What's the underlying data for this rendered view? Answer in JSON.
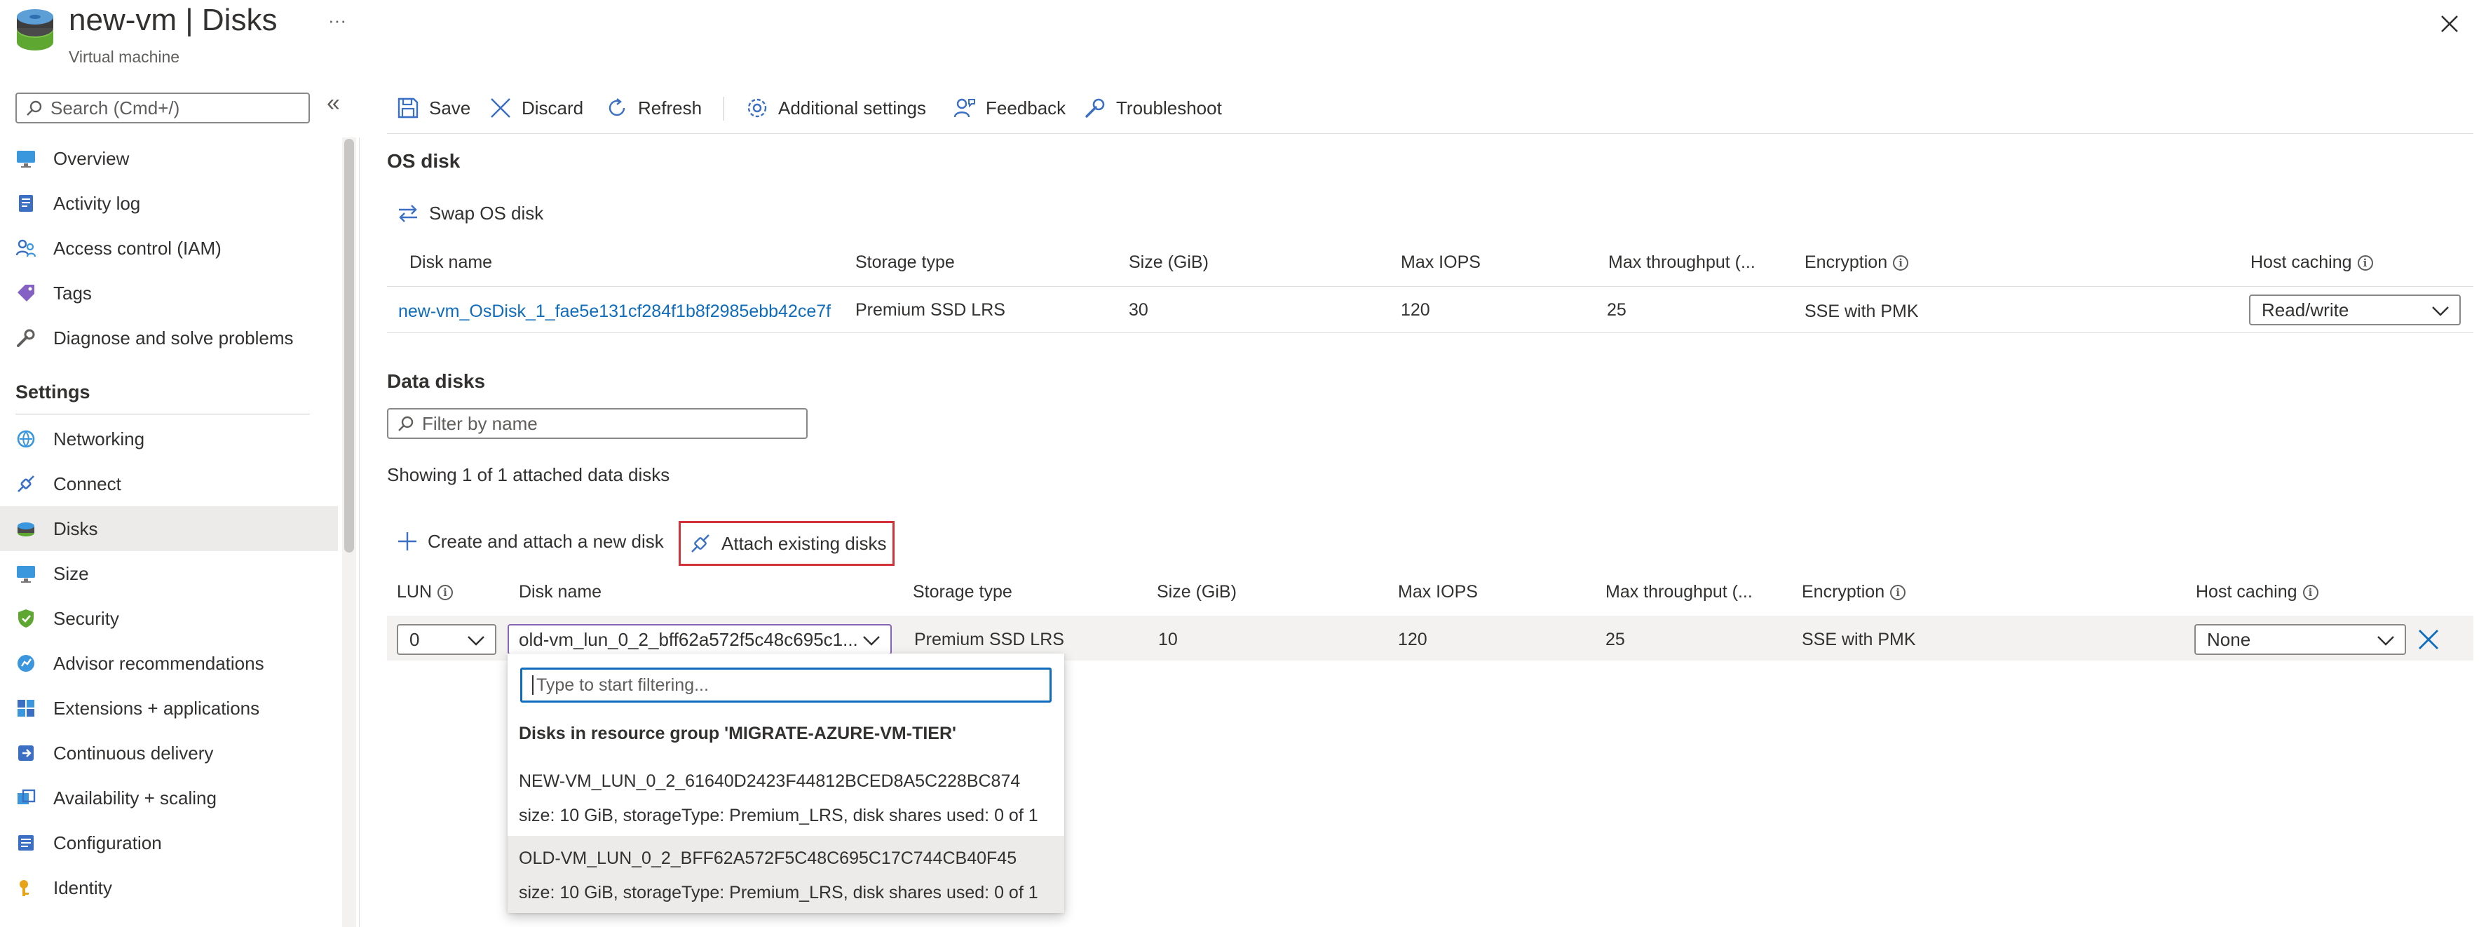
{
  "header": {
    "title": "new-vm | Disks",
    "subtitle": "Virtual machine",
    "more_label": "···"
  },
  "sidebar": {
    "search_placeholder": "Search (Cmd+/)",
    "collapse_label": "«",
    "items": [
      {
        "label": "Overview",
        "icon": "monitor-icon"
      },
      {
        "label": "Activity log",
        "icon": "log-icon"
      },
      {
        "label": "Access control (IAM)",
        "icon": "people-icon"
      },
      {
        "label": "Tags",
        "icon": "tag-icon"
      },
      {
        "label": "Diagnose and solve problems",
        "icon": "wrench-icon"
      }
    ],
    "section_label": "Settings",
    "settings_items": [
      {
        "label": "Networking",
        "icon": "network-icon"
      },
      {
        "label": "Connect",
        "icon": "connect-icon"
      },
      {
        "label": "Disks",
        "icon": "disk-icon",
        "active": true
      },
      {
        "label": "Size",
        "icon": "monitor-icon"
      },
      {
        "label": "Security",
        "icon": "shield-icon"
      },
      {
        "label": "Advisor recommendations",
        "icon": "advisor-icon"
      },
      {
        "label": "Extensions + applications",
        "icon": "extensions-icon"
      },
      {
        "label": "Continuous delivery",
        "icon": "delivery-icon"
      },
      {
        "label": "Availability + scaling",
        "icon": "scaling-icon"
      },
      {
        "label": "Configuration",
        "icon": "config-icon"
      },
      {
        "label": "Identity",
        "icon": "identity-icon"
      }
    ]
  },
  "toolbar": {
    "save": "Save",
    "discard": "Discard",
    "refresh": "Refresh",
    "additional_settings": "Additional settings",
    "feedback": "Feedback",
    "troubleshoot": "Troubleshoot"
  },
  "os_disk": {
    "section_title": "OS disk",
    "swap_label": "Swap OS disk",
    "columns": [
      "Disk name",
      "Storage type",
      "Size (GiB)",
      "Max IOPS",
      "Max throughput (...",
      "Encryption",
      "Host caching"
    ],
    "row": {
      "disk_name": "new-vm_OsDisk_1_fae5e131cf284f1b8f2985ebb42ce7f",
      "storage_type": "Premium SSD LRS",
      "size": "30",
      "max_iops": "120",
      "max_throughput": "25",
      "encryption": "SSE with PMK",
      "host_caching": "Read/write"
    }
  },
  "data_disks": {
    "section_title": "Data disks",
    "filter_placeholder": "Filter by name",
    "showing_text": "Showing 1 of 1 attached data disks",
    "create_attach_label": "Create and attach a new disk",
    "attach_existing_label": "Attach existing disks",
    "columns": [
      "LUN",
      "Disk name",
      "Storage type",
      "Size (GiB)",
      "Max IOPS",
      "Max throughput (...",
      "Encryption",
      "Host caching"
    ],
    "row": {
      "lun": "0",
      "disk_name": "old-vm_lun_0_2_bff62a572f5c48c695c1...",
      "storage_type": "Premium SSD LRS",
      "size": "10",
      "max_iops": "120",
      "max_throughput": "25",
      "encryption": "SSE with PMK",
      "host_caching": "None"
    }
  },
  "dropdown": {
    "filter_placeholder": "Type to start filtering...",
    "group_header": "Disks in resource group 'MIGRATE-AZURE-VM-TIER'",
    "options": [
      {
        "name": "NEW-VM_LUN_0_2_61640D2423F44812BCED8A5C228BC874",
        "detail": "size: 10 GiB, storageType: Premium_LRS, disk shares used: 0 of 1",
        "highlighted": false
      },
      {
        "name": "OLD-VM_LUN_0_2_BFF62A572F5C48C695C17C744CB40F45",
        "detail": "size: 10 GiB, storageType: Premium_LRS, disk shares used: 0 of 1",
        "highlighted": true
      }
    ]
  },
  "colors": {
    "accent": "#0f6cbd",
    "highlight_border": "#d13438",
    "dropdown_border": "#8764b8",
    "active_row": "#f3f2f1"
  }
}
